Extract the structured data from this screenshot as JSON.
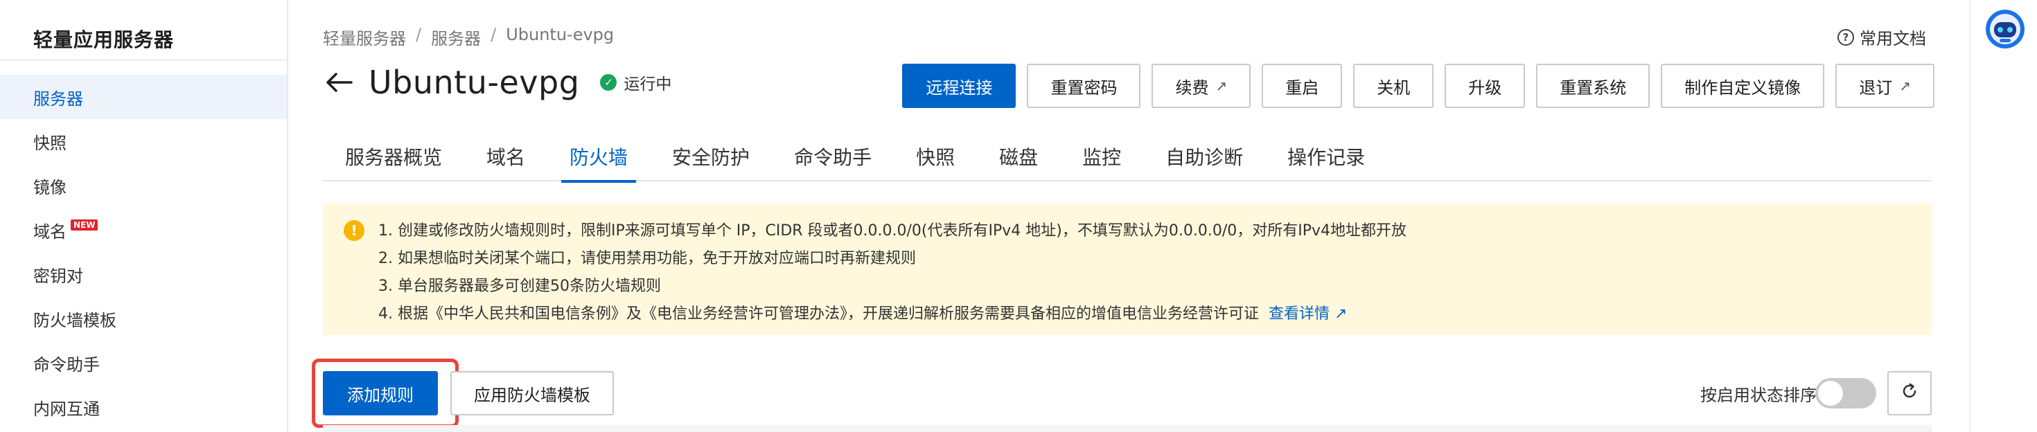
{
  "sidebar": {
    "title": "轻量应用服务器",
    "items": [
      {
        "label": "服务器",
        "active": true
      },
      {
        "label": "快照"
      },
      {
        "label": "镜像"
      },
      {
        "label": "域名",
        "badge": "NEW"
      },
      {
        "label": "密钥对"
      },
      {
        "label": "防火墙模板"
      },
      {
        "label": "命令助手"
      },
      {
        "label": "内网互通"
      }
    ]
  },
  "breadcrumb": {
    "items": [
      "轻量服务器",
      "服务器",
      "Ubuntu-evpg"
    ],
    "separator": "/"
  },
  "header": {
    "help_link": "常用文档",
    "title": "Ubuntu-evpg",
    "status": "运行中",
    "actions": {
      "remote": "远程连接",
      "reset_password": "重置密码",
      "renew": "续费",
      "restart": "重启",
      "shutdown": "关机",
      "upgrade": "升级",
      "reset_system": "重置系统",
      "custom_image": "制作自定义镜像",
      "unsubscribe": "退订"
    }
  },
  "tabs": [
    {
      "label": "服务器概览"
    },
    {
      "label": "域名"
    },
    {
      "label": "防火墙",
      "active": true
    },
    {
      "label": "安全防护"
    },
    {
      "label": "命令助手"
    },
    {
      "label": "快照"
    },
    {
      "label": "磁盘"
    },
    {
      "label": "监控"
    },
    {
      "label": "自助诊断"
    },
    {
      "label": "操作记录"
    }
  ],
  "notice": {
    "lines": [
      "1. 创建或修改防火墙规则时，限制IP来源可填写单个 IP，CIDR 段或者0.0.0.0/0(代表所有IPv4 地址)，不填写默认为0.0.0.0/0，对所有IPv4地址都开放",
      "2. 如果想临时关闭某个端口，请使用禁用功能，免于开放对应端口时再新建规则",
      "3. 单台服务器最多可创建50条防火墙规则",
      "4. 根据《中华人民共和国电信条例》及《电信业务经营许可管理办法》，开展递归解析服务需要具备相应的增值电信业务经营许可证"
    ],
    "link": "查看详情"
  },
  "firewall_toolbar": {
    "add_rule": "添加规则",
    "apply_template": "应用防火墙模板",
    "sort_label": "按启用状态排序",
    "sort_enabled": false
  },
  "colors": {
    "primary": "#0064c8",
    "running": "#1aa35a",
    "warning": "#f7b500",
    "notice_bg": "#fff8dc",
    "highlight": "#e8453c"
  },
  "icons": {
    "back": "arrow-left-icon",
    "help": "question-circle-icon",
    "status": "check-circle-icon",
    "external": "external-link-icon",
    "warning": "warning-circle-icon",
    "refresh": "refresh-icon",
    "assistant": "robot-assistant-icon"
  }
}
